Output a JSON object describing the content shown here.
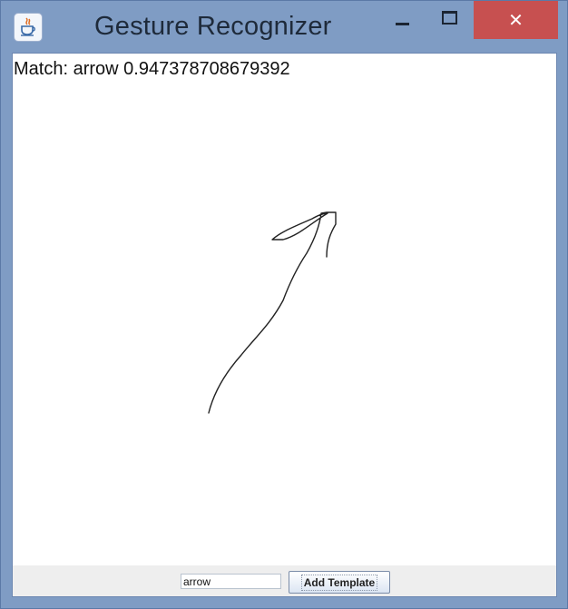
{
  "window": {
    "title": "Gesture Recognizer",
    "close_glyph": "✕"
  },
  "canvas": {
    "match_text": "Match: arrow 0.947378708679392"
  },
  "controls": {
    "template_name_value": "arrow",
    "add_button_label": "Add Template"
  },
  "colors": {
    "frame": "#7f9cc4",
    "close_button": "#c75050",
    "stroke": "#222222"
  },
  "icons": {
    "app": "java-coffee-icon",
    "minimize": "minimize-icon",
    "maximize": "maximize-icon",
    "close": "close-icon"
  }
}
